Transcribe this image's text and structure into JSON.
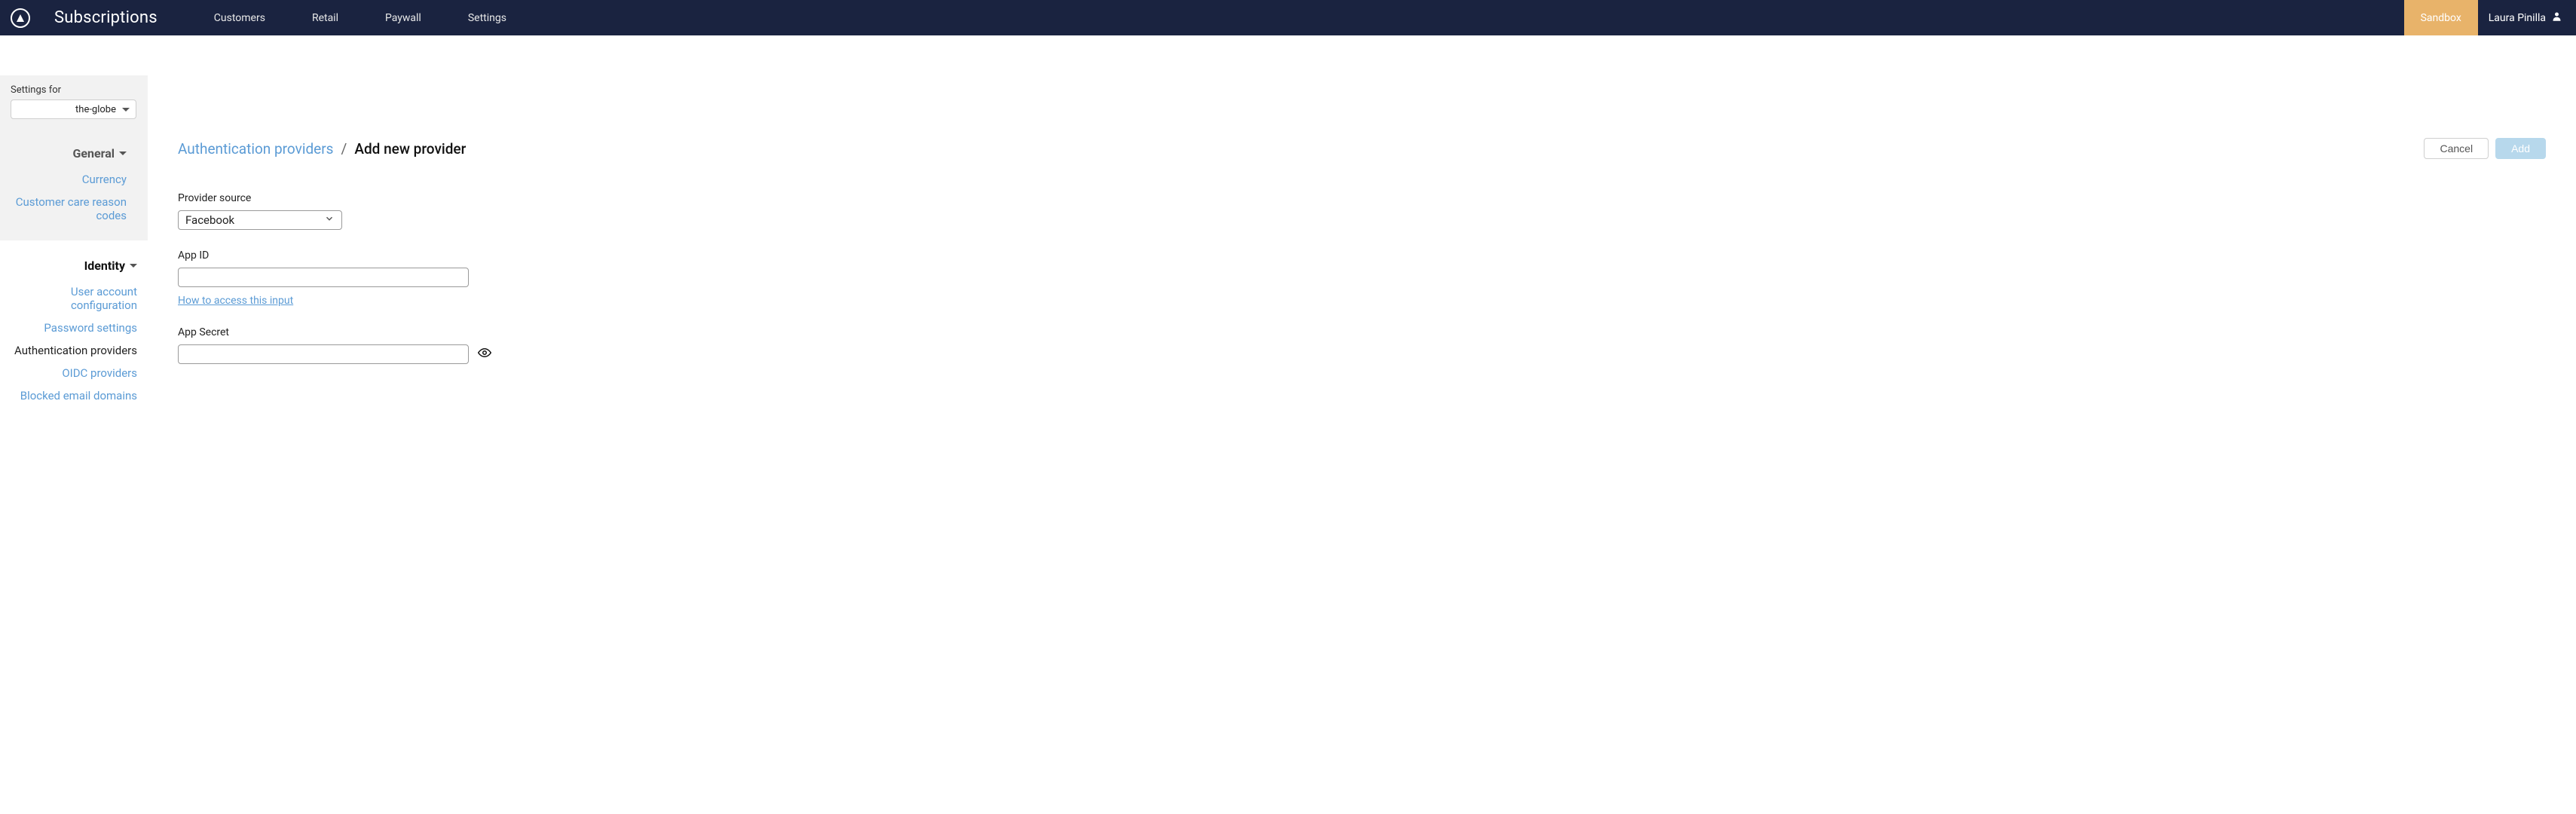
{
  "header": {
    "app_title": "Subscriptions",
    "nav": {
      "customers": "Customers",
      "retail": "Retail",
      "paywall": "Paywall",
      "settings": "Settings"
    },
    "sandbox_label": "Sandbox",
    "user_name": "Laura Pinilla"
  },
  "sidebar": {
    "settings_for_label": "Settings for",
    "site_selected": "the-globe",
    "groups": {
      "general": {
        "label": "General",
        "items": {
          "currency": "Currency",
          "reason_codes": "Customer care reason codes"
        }
      },
      "identity": {
        "label": "Identity",
        "items": {
          "user_account": "User account configuration",
          "password": "Password settings",
          "auth_providers": "Authentication providers",
          "oidc": "OIDC providers",
          "blocked_email": "Blocked email domains"
        }
      }
    }
  },
  "breadcrumb": {
    "parent": "Authentication providers",
    "separator": "/",
    "current": "Add new provider"
  },
  "actions": {
    "cancel": "Cancel",
    "add": "Add"
  },
  "form": {
    "provider_source": {
      "label": "Provider source",
      "value": "Facebook"
    },
    "app_id": {
      "label": "App ID",
      "value": "",
      "help_link": "How to access this input"
    },
    "app_secret": {
      "label": "App Secret",
      "value": ""
    }
  }
}
